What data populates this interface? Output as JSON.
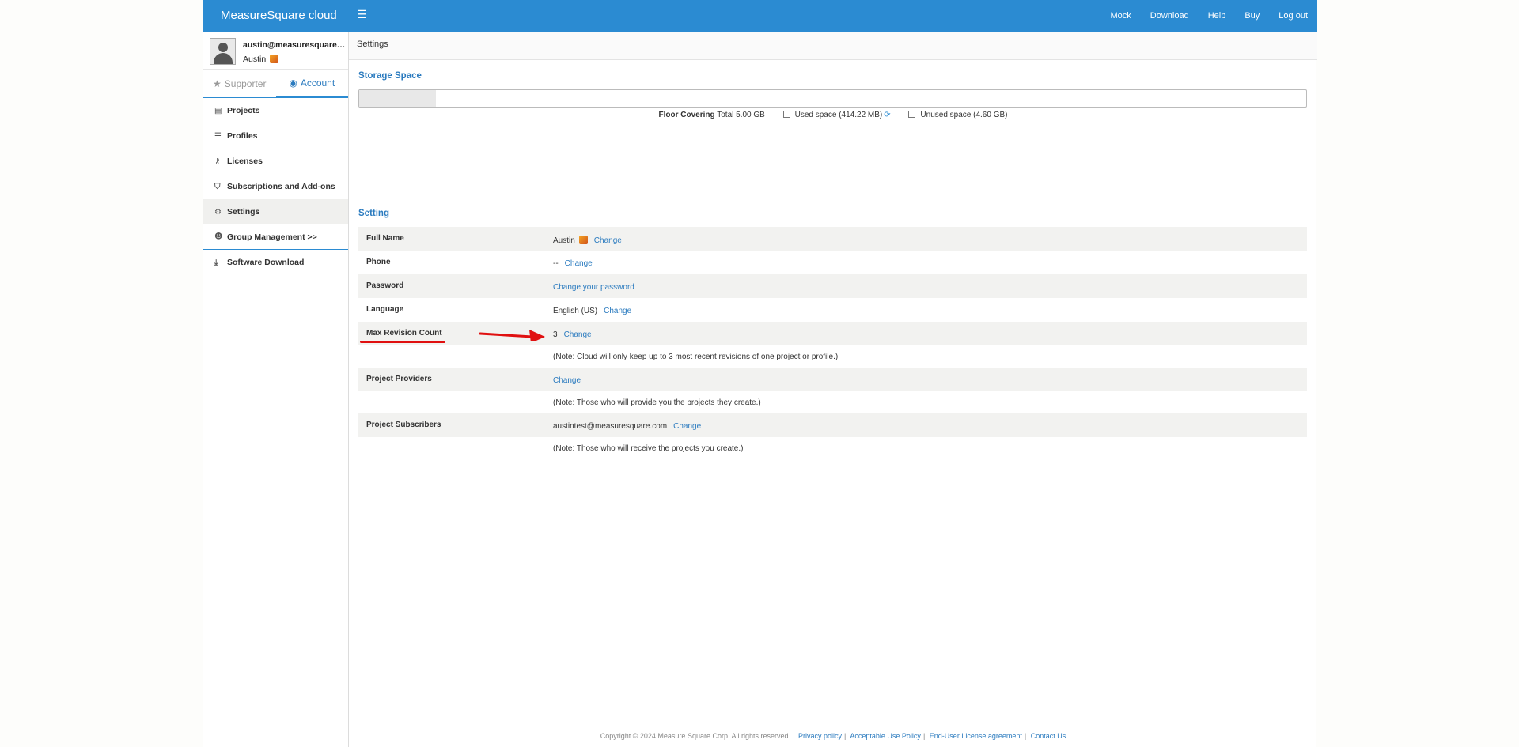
{
  "header": {
    "brand": "MeasureSquare cloud",
    "menu_icon": "hamburger-icon",
    "nav": [
      "Mock",
      "Download",
      "Help",
      "Buy",
      "Log out"
    ]
  },
  "user": {
    "email": "austin@measuresquare.c...",
    "name": "Austin"
  },
  "tabs": {
    "supporter": "Supporter",
    "account": "Account"
  },
  "sidebar": {
    "items": [
      {
        "label": "Projects",
        "icon": "file-icon"
      },
      {
        "label": "Profiles",
        "icon": "database-icon"
      },
      {
        "label": "Licenses",
        "icon": "key-icon"
      },
      {
        "label": "Subscriptions and Add-ons",
        "icon": "tags-icon"
      },
      {
        "label": "Settings",
        "icon": "gear-icon"
      },
      {
        "label": "Group Management >>",
        "icon": "users-icon"
      },
      {
        "label": "Software Download",
        "icon": "download-icon"
      }
    ]
  },
  "breadcrumb": "Settings",
  "storage": {
    "title": "Storage Space",
    "product": "Floor Covering",
    "total": "Total 5.00 GB",
    "used": "Used space (414.22 MB)",
    "unused": "Unused space (4.60 GB)",
    "used_fraction": 0.081
  },
  "setting": {
    "title": "Setting",
    "full_name_label": "Full Name",
    "full_name_value": "Austin",
    "phone_label": "Phone",
    "phone_value": "--",
    "password_label": "Password",
    "password_link": "Change your password",
    "language_label": "Language",
    "language_value": "English (US)",
    "max_revision_label": "Max Revision Count",
    "max_revision_value": "3",
    "max_revision_note": "(Note: Cloud will only keep up to 3 most recent revisions of one project or profile.)",
    "providers_label": "Project Providers",
    "providers_note": "(Note: Those who will provide you the projects they create.)",
    "subscribers_label": "Project Subscribers",
    "subscribers_value": "austintest@measuresquare.com",
    "subscribers_note": "(Note: Those who will receive the projects you create.)",
    "change": "Change"
  },
  "footer": {
    "copyright": "Copyright © 2024 Measure Square Corp. All rights reserved.",
    "links": [
      "Privacy policy",
      "Acceptable Use Policy",
      "End-User License agreement",
      "Contact Us"
    ]
  },
  "colors": {
    "brand_blue": "#2b8bd2",
    "link": "#2b7bbf",
    "annotation_red": "#e01010"
  }
}
